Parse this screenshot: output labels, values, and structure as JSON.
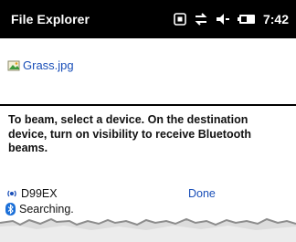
{
  "titlebar": {
    "app_title": "File Explorer",
    "clock": "7:42",
    "icons": [
      "keyboard-icon",
      "sync-arrows-icon",
      "speaker-icon",
      "battery-icon"
    ]
  },
  "file": {
    "icon": "image-file-icon",
    "name": "Grass.jpg"
  },
  "instructions": "To beam, select a device. On the destination device, turn on visibility to receive Bluetooth beams.",
  "devices": [
    {
      "icon": "wireless-device-icon",
      "name": "D99EX"
    }
  ],
  "done_label": "Done",
  "status": {
    "icon": "bluetooth-icon",
    "text": "Searching."
  },
  "colors": {
    "titlebar_bg": "#000000",
    "link": "#1a4fb8"
  }
}
